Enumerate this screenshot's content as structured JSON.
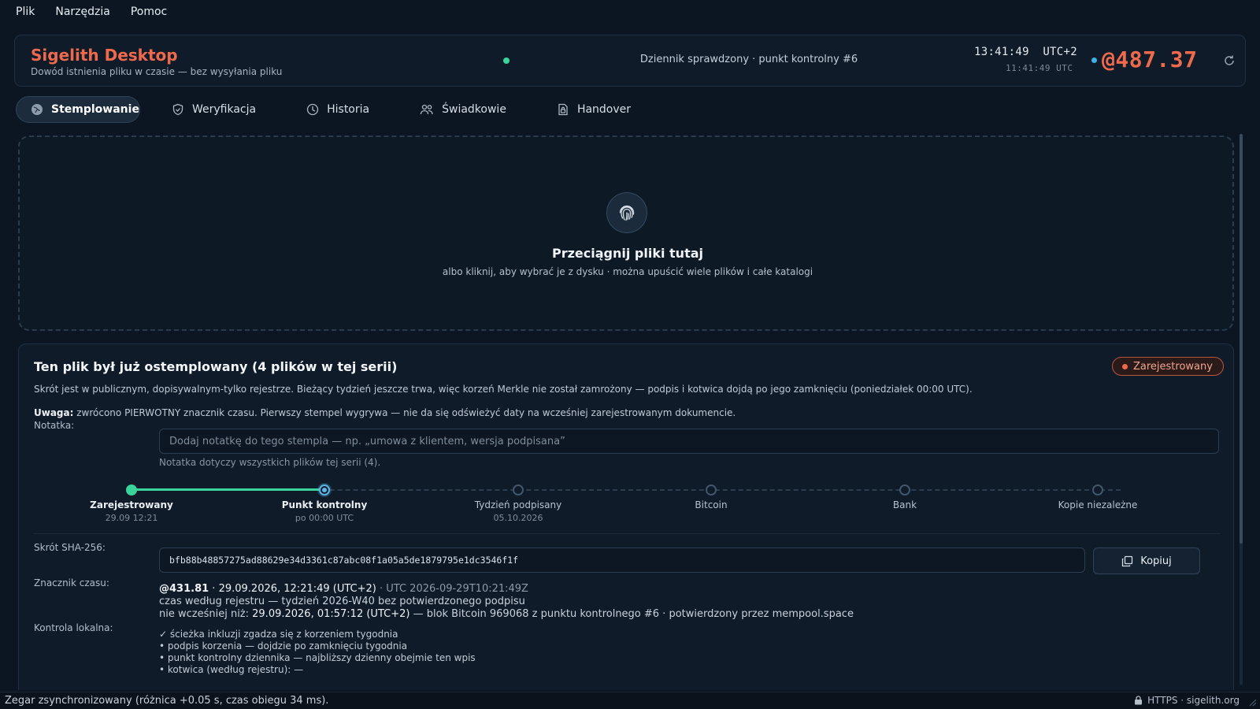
{
  "menu": {
    "file": "Plik",
    "tools": "Narzędzia",
    "help": "Pomoc"
  },
  "header": {
    "title": "Sigelith Desktop",
    "subtitle": "Dowód istnienia pliku w czasie — bez wysyłania pliku",
    "status": "Dziennik sprawdzony · punkt kontrolny #6",
    "local_time": "13:41:49",
    "tz": "UTC+2",
    "utc_time": "11:41:49 UTC",
    "beat": "@487.37",
    "colors": {
      "accent": "#ef6a4c",
      "ok": "#3ad39a",
      "info": "#3eb2e6"
    }
  },
  "tabs": [
    {
      "label": "Stemplowanie",
      "icon": "globe-icon",
      "active": true
    },
    {
      "label": "Weryfikacja",
      "icon": "shield-icon"
    },
    {
      "label": "Historia",
      "icon": "clock-icon"
    },
    {
      "label": "Świadkowie",
      "icon": "users-icon"
    },
    {
      "label": "Handover",
      "icon": "document-lock-icon"
    }
  ],
  "dropzone": {
    "title": "Przeciągnij pliki tutaj",
    "subtitle": "albo kliknij, aby wybrać je z dysku · można upuścić wiele plików i całe katalogi"
  },
  "result": {
    "title": "Ten plik był już ostemplowany (4 plików w tej serii)",
    "badge": "Zarejestrowany",
    "info": "Skrót jest w publicznym, dopisywalnym-tylko rejestrze. Bieżący tydzień jeszcze trwa, więc korzeń Merkle nie został zamrożony — podpis i kotwica dojdą po jego zamknięciu (poniedziałek 00:00 UTC).",
    "warning_label": "Uwaga:",
    "warning_text": " zwrócono PIERWOTNY znacznik czasu. Pierwszy stempel wygrywa — nie da się odświeżyć daty na wcześniej zarejestrowanym dokumencie.",
    "note_label": "Notatka:",
    "note_placeholder": "Dodaj notatkę do tego stempla — np. „umowa z klientem, wersja podpisana”",
    "note_value": "",
    "note_hint": "Notatka dotyczy wszystkich plików tej serii (4).",
    "timeline": [
      {
        "name": "Zarejestrowany",
        "date": "29.09 12:21",
        "state": "done"
      },
      {
        "name": "Punkt kontrolny",
        "date": "po 00:00 UTC",
        "state": "current"
      },
      {
        "name": "Tydzień podpisany",
        "date": "05.10.2026",
        "state": "pending"
      },
      {
        "name": "Bitcoin",
        "date": "",
        "state": "pending"
      },
      {
        "name": "Bank",
        "date": "",
        "state": "pending"
      },
      {
        "name": "Kopie niezależne",
        "date": "",
        "state": "pending"
      }
    ],
    "hash_label": "Skrót SHA-256:",
    "hash": "bfb88b48857275ad88629e34d3361c87abc08f1a05a5de1879795e1dc3546f1f",
    "copy_label": "Kopiuj",
    "timestamp_label": "Znacznik czasu:",
    "ts_beat": "@431.81",
    "ts_local": " · 29.09.2026, 12:21:49 (UTC+2)",
    "ts_utc": " · UTC 2026-09-29T10:21:49Z",
    "ts_line2": "czas według rejestru — tydzień 2026-W40 bez potwierdzonego podpisu",
    "ts_line3_prefix": "nie wcześniej niż: ",
    "ts_line3_date": "29.09.2026, 01:57:12 (UTC+2)",
    "ts_line3_suffix": " — blok Bitcoin 969068 z punktu kontrolnego #6 · potwierdzony przez mempool.space",
    "local_label": "Kontrola lokalna:",
    "local_checks": [
      "✓ ścieżka inkluzji zgadza się z korzeniem tygodnia",
      "• podpis korzenia — dojdzie po zamknięciu tygodnia",
      "• punkt kontrolny dziennika — najbliższy dzienny obejmie ten wpis",
      "• kotwica (według rejestru): —"
    ]
  },
  "statusbar": {
    "left": "Zegar zsynchronizowany (różnica +0.05 s, czas obiegu 34 ms).",
    "right": "HTTPS · sigelith.org"
  }
}
